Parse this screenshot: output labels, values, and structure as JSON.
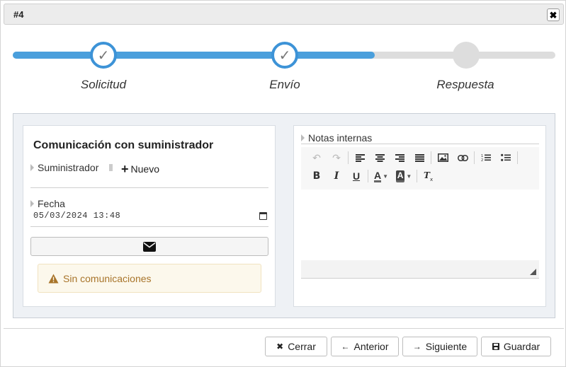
{
  "dialog": {
    "title": "#4",
    "close_glyph": "✖"
  },
  "stepper": {
    "progress_percent": 66.7,
    "steps": [
      {
        "label": "Solicitud",
        "state": "done",
        "icon": "check-icon"
      },
      {
        "label": "Envío",
        "state": "done",
        "icon": "check-icon"
      },
      {
        "label": "Respuesta",
        "state": "pending",
        "icon": ""
      }
    ]
  },
  "left_panel": {
    "title": "Comunicación con suministrador",
    "supplier_label": "Suministrador",
    "new_label": "Nuevo",
    "date_label": "Fecha",
    "date_value": "05/03/2024 13:48",
    "send_button_icon": "envelope-icon",
    "alert_text": "Sin comunicaciones",
    "alert_icon": "warning-icon"
  },
  "right_panel": {
    "notes_label": "Notas internas",
    "editor_content": ""
  },
  "footer": {
    "close_label": "Cerrar",
    "prev_label": "Anterior",
    "next_label": "Siguiente",
    "save_label": "Guardar"
  },
  "colors": {
    "accent": "#4a9fdc",
    "track": "#dddddd",
    "alert_bg": "#fcf8ec",
    "alert_text": "#a8742a"
  }
}
